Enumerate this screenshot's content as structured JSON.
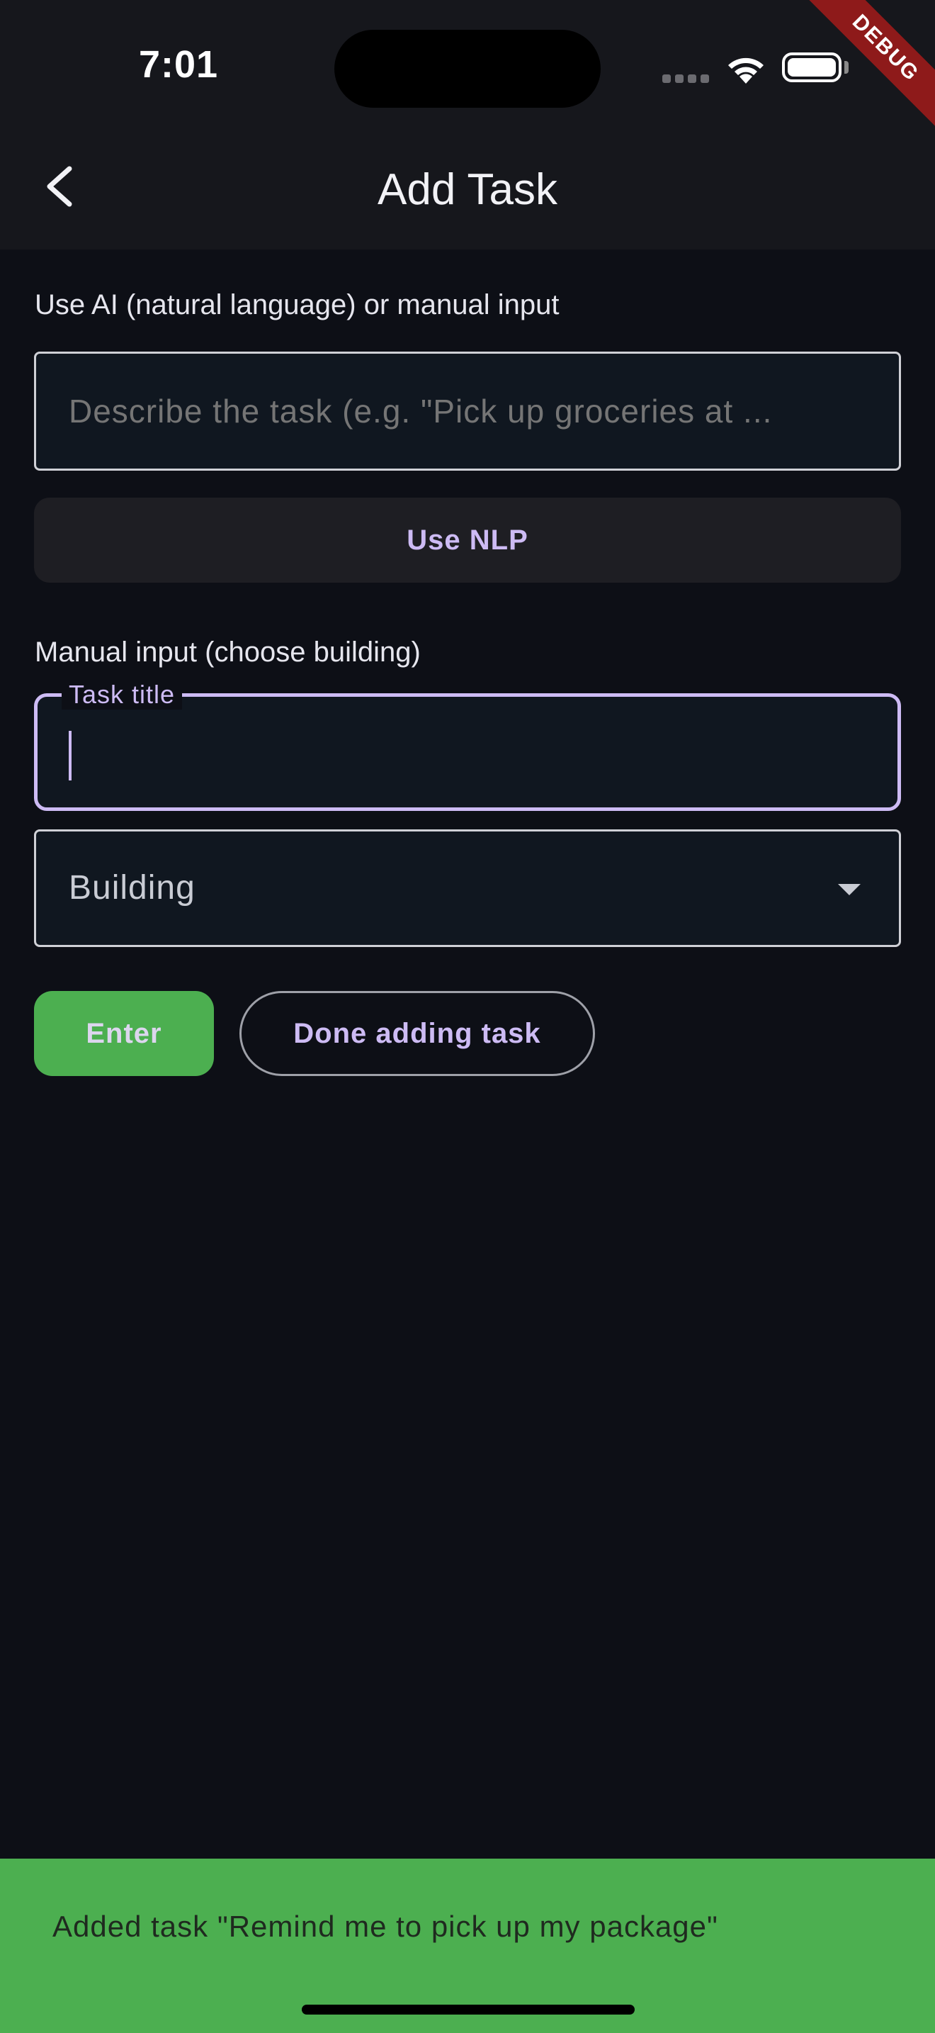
{
  "status_bar": {
    "time": "7:01",
    "debug_label": "DEBUG"
  },
  "app_bar": {
    "title": "Add Task",
    "back_icon": "chevron-left-icon"
  },
  "ai_section": {
    "label": "Use AI (natural language) or manual input",
    "input_value": "",
    "input_placeholder": "Describe the task (e.g. \"Pick up groceries at ...",
    "nlp_button_label": "Use NLP"
  },
  "manual_section": {
    "label": "Manual input (choose building)",
    "task_title_label": "Task title",
    "task_title_value": "",
    "building_placeholder": "Building",
    "enter_label": "Enter",
    "done_label": "Done adding task"
  },
  "snackbar": {
    "message": "Added task \"Remind me to pick up my package\""
  },
  "colors": {
    "accent": "#cdbbf4",
    "success": "#4caf50",
    "background": "#0d0f16",
    "app_bar": "#16171c",
    "debug_banner": "#8e1a1a"
  }
}
